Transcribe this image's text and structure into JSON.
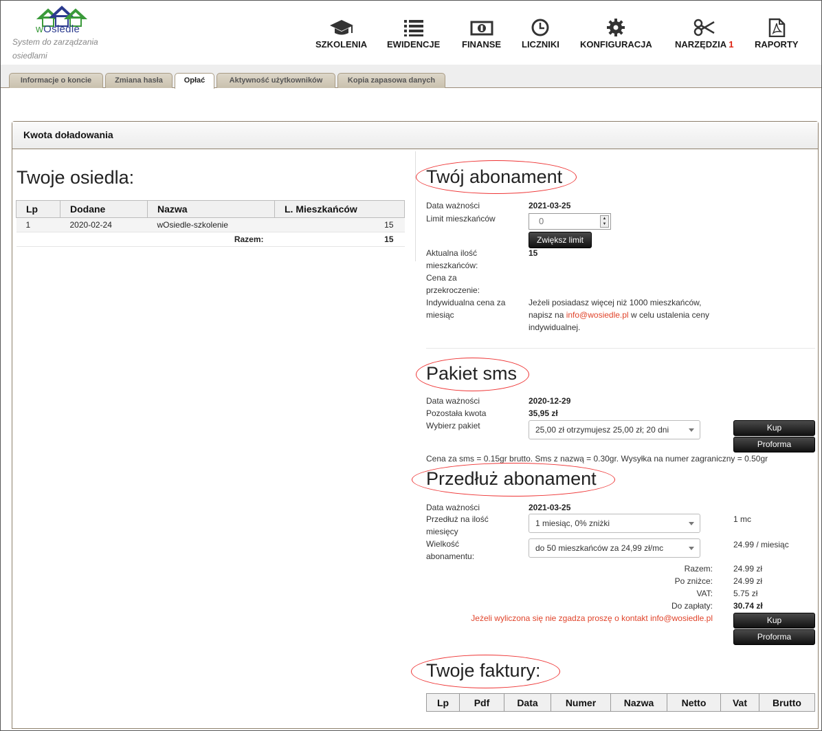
{
  "app": {
    "logo_text_part1": "w",
    "logo_text_part2": "Osiedle",
    "tagline": "System do zarządzania osiedlami"
  },
  "nav": [
    {
      "label": "SZKOLENIA",
      "icon": "graduation-cap-icon"
    },
    {
      "label": "EWIDENCJE",
      "icon": "list-icon"
    },
    {
      "label": "FINANSE",
      "icon": "banknote-icon"
    },
    {
      "label": "LICZNIKI",
      "icon": "clock-icon"
    },
    {
      "label": "KONFIGURACJA",
      "icon": "gear-icon"
    },
    {
      "label": "NARZĘDZIA",
      "badge": "1",
      "icon": "scissors-icon"
    },
    {
      "label": "RAPORTY",
      "icon": "pdf-icon"
    }
  ],
  "tabs": [
    "Informacje o koncie",
    "Zmiana hasła",
    "Opłać",
    "Aktywność użytkowników",
    "Kopia zapasowa danych"
  ],
  "active_tab": "Opłać",
  "panel_title": "Kwota doładowania",
  "settlements": {
    "title": "Twoje osiedla:",
    "headers": [
      "Lp",
      "Dodane",
      "Nazwa",
      "L. Mieszkańców"
    ],
    "rows": [
      {
        "lp": "1",
        "added": "2020-02-24",
        "name": "wOsiedle-szkolenie",
        "residents": "15"
      }
    ],
    "total_label": "Razem:",
    "total_value": "15"
  },
  "subscription": {
    "title": "Twój abonament",
    "expiry_label": "Data ważności",
    "expiry_value": "2021-03-25",
    "limit_label": "Limit mieszkańców",
    "limit_value": "0",
    "increase_button": "Zwiększ limit",
    "current_label": "Aktualna ilość mieszkańców:",
    "current_value": "15",
    "overrun_label": "Cena za przekroczenie:",
    "individual_label": "Indywidualna cena za miesiąc",
    "individual_text_1": "Jeżeli posiadasz więcej niż 1000 mieszkańców, napisz na ",
    "individual_email": "info@wosiedle.pl",
    "individual_text_2": " w celu ustalenia ceny indywidualnej."
  },
  "sms": {
    "title": "Pakiet sms",
    "expiry_label": "Data ważności",
    "expiry_value": "2020-12-29",
    "remaining_label": "Pozostała kwota",
    "remaining_value": "35,95 zł",
    "package_label": "Wybierz pakiet",
    "package_value": "25,00 zł otrzymujesz 25,00 zł; 20 dni",
    "buy_button": "Kup",
    "proforma_button": "Proforma",
    "price_note": "Cena za sms = 0.15gr brutto. Sms z nazwą = 0.30gr. Wysyłka na numer zagraniczny = 0.50gr"
  },
  "extend": {
    "title": "Przedłuż abonament",
    "expiry_label": "Data ważności",
    "expiry_value": "2021-03-25",
    "months_label": "Przedłuż na ilość miesięcy",
    "months_value": "1 miesiąc, 0% zniżki",
    "months_summary": "1 mc",
    "size_label": "Wielkość abonamentu:",
    "size_value": "do 50 mieszkańców za 24,99 zł/mc",
    "size_summary": "24.99 / miesiąc",
    "totals": [
      {
        "label": "Razem:",
        "value": "24.99 zł"
      },
      {
        "label": "Po zniżce:",
        "value": "24.99 zł"
      },
      {
        "label": "VAT:",
        "value": "5.75 zł"
      },
      {
        "label": "Do zapłaty:",
        "value": "30.74 zł"
      }
    ],
    "contact_note": "Jeżeli wyliczona się nie zgadza proszę o kontakt info@wosiedle.pl",
    "buy_button": "Kup",
    "proforma_button": "Proforma"
  },
  "invoices": {
    "title": "Twoje faktury:",
    "headers": [
      "Lp",
      "Pdf",
      "Data",
      "Numer",
      "Nazwa",
      "Netto",
      "Vat",
      "Brutto"
    ]
  },
  "colors": {
    "accent_red": "#e0432a",
    "tab_bg": "#cfc6b4",
    "border": "#8c7e6a"
  }
}
